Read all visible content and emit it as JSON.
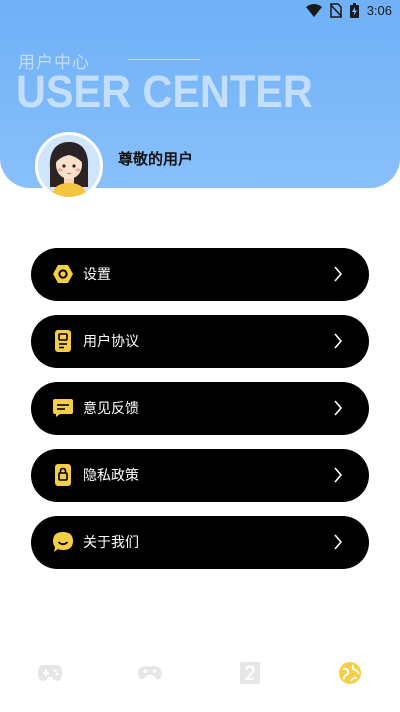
{
  "status_bar": {
    "time": "3:06",
    "icons": [
      "wifi-icon",
      "no-sim-icon",
      "battery-charging-icon"
    ]
  },
  "header": {
    "title_cn": "用户中心",
    "title_en": "USER CENTER"
  },
  "profile": {
    "username": "尊敬的用户"
  },
  "menu": {
    "items": [
      {
        "label": "设置",
        "icon": "settings-icon"
      },
      {
        "label": "用户协议",
        "icon": "document-icon"
      },
      {
        "label": "意见反馈",
        "icon": "feedback-icon"
      },
      {
        "label": "隐私政策",
        "icon": "privacy-icon"
      },
      {
        "label": "关于我们",
        "icon": "about-icon"
      }
    ]
  },
  "tabbar": {
    "tabs": [
      {
        "icon": "gamepad-icon",
        "active": false
      },
      {
        "icon": "controller-icon",
        "active": false
      },
      {
        "icon": "number-card-icon",
        "active": false
      },
      {
        "icon": "globe-icon",
        "active": true
      }
    ]
  },
  "colors": {
    "header_blue": "#6fb0f7",
    "accent_yellow": "#f5cd47",
    "menu_bg": "#000000",
    "inactive_tab": "#e9e9e9"
  }
}
